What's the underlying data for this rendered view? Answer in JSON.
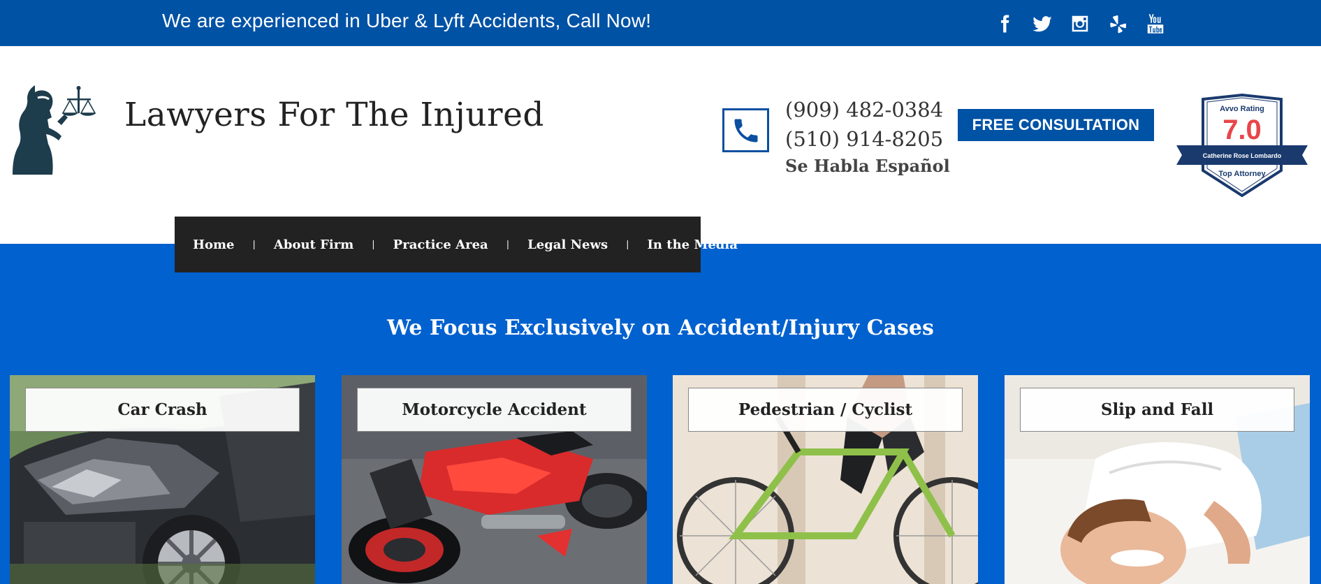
{
  "topbar": {
    "tagline": "We are experienced in Uber & Lyft Accidents, Call Now!",
    "social": [
      "facebook-icon",
      "twitter-icon",
      "instagram-icon",
      "yelp-icon",
      "youtube-icon"
    ]
  },
  "header": {
    "site_title": "Lawyers For The Injured",
    "phone_1": "(909) 482-0384",
    "phone_2": "(510) 914-8205",
    "spanish": "Se Habla Español",
    "cta": "FREE CONSULTATION",
    "avvo": {
      "label": "Avvo Rating",
      "score": "7.0",
      "name": "Catherine Rose Lombardo",
      "title": "Top Attorney"
    }
  },
  "nav": {
    "items": [
      "Home",
      "About Firm",
      "Practice Area",
      "Legal News",
      "In the Media"
    ]
  },
  "main": {
    "heading": "We Focus Exclusively on Accident/Injury Cases",
    "cards": [
      {
        "label": "Car Crash"
      },
      {
        "label": "Motorcycle Accident"
      },
      {
        "label": "Pedestrian / Cyclist"
      },
      {
        "label": "Slip and Fall"
      }
    ]
  },
  "colors": {
    "topbar": "#0052a5",
    "section": "#0061cf",
    "nav": "#222222",
    "avvo_score": "#e8454a"
  }
}
